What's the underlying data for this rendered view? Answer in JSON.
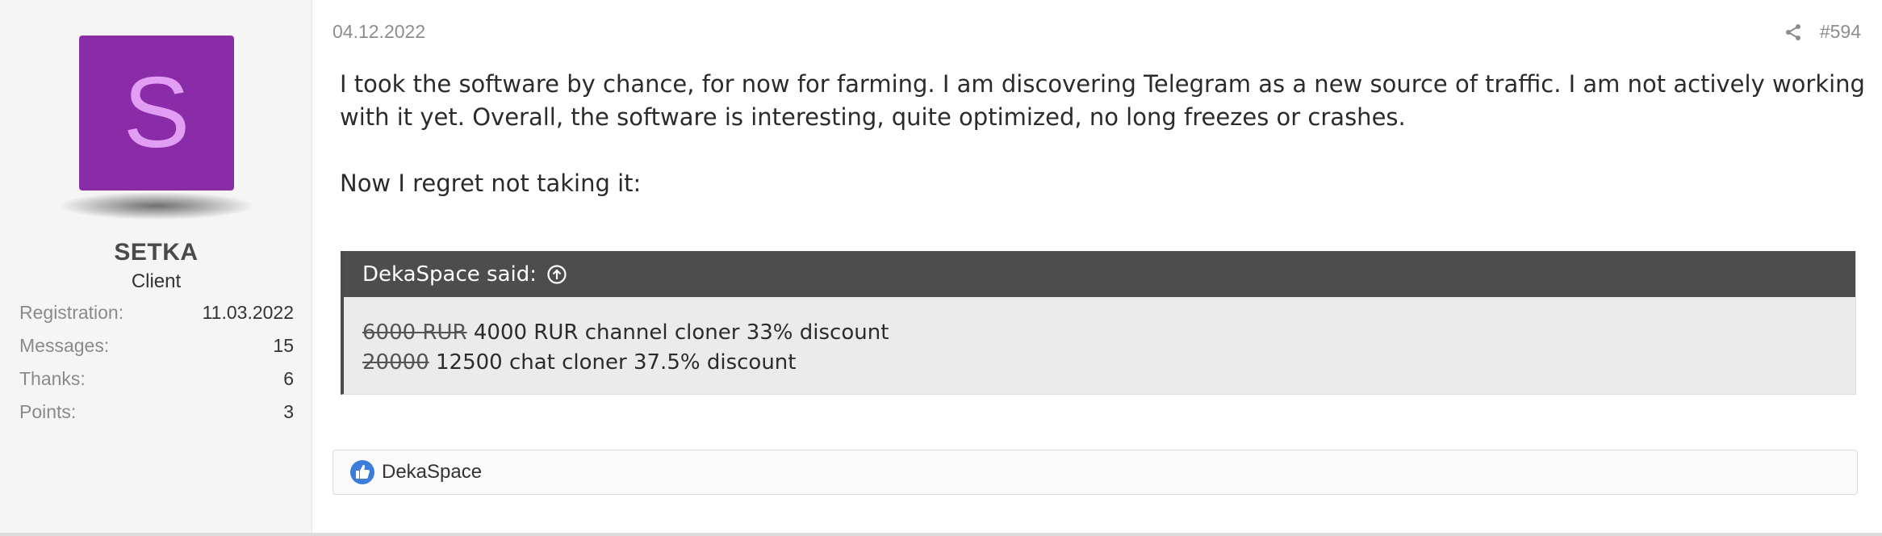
{
  "user": {
    "avatar_letter": "S",
    "avatar_color": "#8a2ca8",
    "avatar_letter_color": "#e29df5",
    "name": "SETKA",
    "title": "Client",
    "stats": [
      {
        "label": "Registration:",
        "value": "11.03.2022"
      },
      {
        "label": "Messages:",
        "value": "15"
      },
      {
        "label": "Thanks:",
        "value": "6"
      },
      {
        "label": "Points:",
        "value": "3"
      }
    ]
  },
  "post": {
    "date": "04.12.2022",
    "number": "#594",
    "share_icon": "share-icon",
    "paragraphs": [
      "I took the software by chance, for now for farming. I am discovering Telegram as a new source of traffic. I am not actively working with it yet. Overall, the software is interesting, quite optimized, no long freezes or crashes.",
      "Now I regret not taking it:"
    ],
    "quote": {
      "author_said": "DekaSpace said:",
      "jump_icon": "arrow-up-circle-icon",
      "lines": [
        {
          "struck": "6000 RUR",
          "text": " 4000 RUR channel cloner 33% discount"
        },
        {
          "struck": "20000",
          "text": " 12500 chat cloner 37.5% discount"
        }
      ]
    },
    "reactions": {
      "icon": "thumbs-up-icon",
      "users": "DekaSpace",
      "icon_color": "#3b7dd8"
    }
  }
}
